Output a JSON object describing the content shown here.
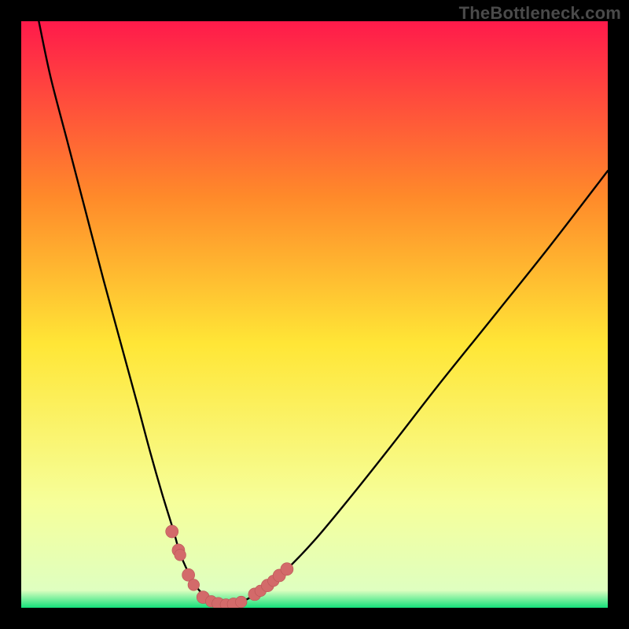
{
  "watermark": "TheBottleneck.com",
  "colors": {
    "frame_bg": "#000000",
    "gradient_top": "#ff1a4b",
    "gradient_mid_upper": "#ff8a2a",
    "gradient_mid": "#ffe636",
    "gradient_lower": "#f6ff9a",
    "gradient_bottom": "#14e07a",
    "curve": "#000000",
    "marker_fill": "#d36a6a",
    "marker_stroke": "#b95555"
  },
  "chart_data": {
    "type": "line",
    "title": "",
    "xlabel": "",
    "ylabel": "",
    "xlim": [
      0,
      100
    ],
    "ylim": [
      0,
      100
    ],
    "series": [
      {
        "name": "bottleneck-curve",
        "x": [
          3,
          5,
          8,
          11,
          14,
          17,
          20,
          22,
          24,
          26,
          27,
          28.5,
          30,
          32,
          34,
          36,
          38,
          41,
          45,
          50,
          56,
          63,
          71,
          80,
          90,
          100
        ],
        "values": [
          100,
          90.5,
          79,
          67.5,
          56,
          45,
          34,
          26.5,
          19.5,
          13,
          9.5,
          6,
          3.4,
          1.4,
          0.5,
          0.5,
          1.2,
          3,
          6.3,
          11.5,
          18.7,
          27.5,
          37.8,
          49,
          61.5,
          74.5
        ]
      }
    ],
    "markers": [
      {
        "x": 25.7,
        "y": 13.0,
        "r": 1.1
      },
      {
        "x": 26.8,
        "y": 9.8,
        "r": 1.1
      },
      {
        "x": 27.1,
        "y": 9.0,
        "r": 1.0
      },
      {
        "x": 28.5,
        "y": 5.6,
        "r": 1.1
      },
      {
        "x": 29.4,
        "y": 3.9,
        "r": 1.0
      },
      {
        "x": 31.0,
        "y": 1.8,
        "r": 1.1
      },
      {
        "x": 32.4,
        "y": 1.1,
        "r": 1.0
      },
      {
        "x": 33.6,
        "y": 0.7,
        "r": 1.1
      },
      {
        "x": 34.9,
        "y": 0.55,
        "r": 1.0
      },
      {
        "x": 36.2,
        "y": 0.6,
        "r": 1.1
      },
      {
        "x": 37.5,
        "y": 1.0,
        "r": 1.0
      },
      {
        "x": 39.8,
        "y": 2.3,
        "r": 1.1
      },
      {
        "x": 40.8,
        "y": 2.9,
        "r": 1.0
      },
      {
        "x": 42.0,
        "y": 3.8,
        "r": 1.1
      },
      {
        "x": 43.0,
        "y": 4.6,
        "r": 1.0
      },
      {
        "x": 44.0,
        "y": 5.5,
        "r": 1.1
      },
      {
        "x": 45.3,
        "y": 6.6,
        "r": 1.1
      }
    ]
  }
}
